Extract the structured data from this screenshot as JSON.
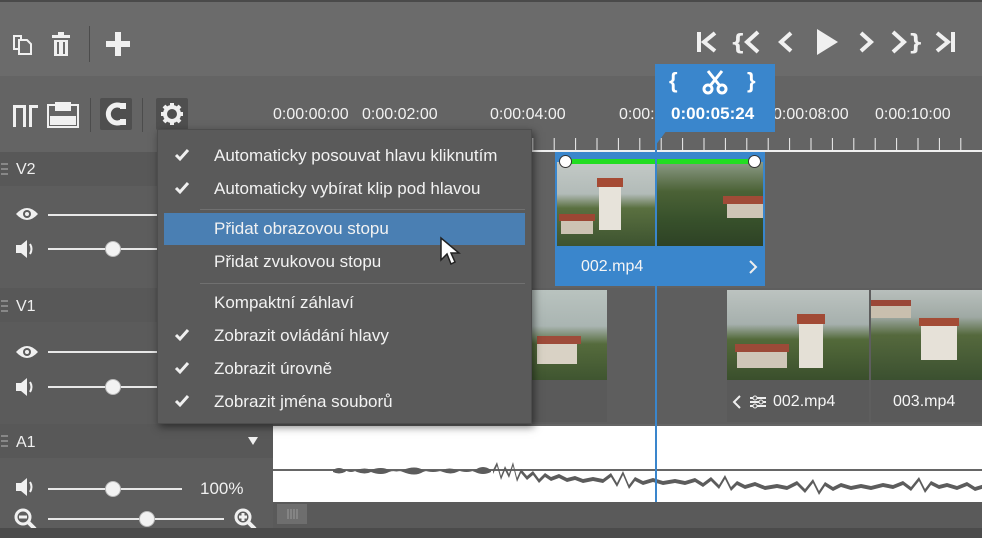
{
  "toolbar": {
    "left_icons": [
      "copy-icon",
      "trash-icon",
      "add-icon"
    ],
    "transport_icons": [
      "skip-to-start-icon",
      "previous-edit-icon",
      "step-back-icon",
      "play-icon",
      "step-forward-icon",
      "next-edit-icon",
      "skip-to-end-icon"
    ],
    "timeline_tools": [
      "ripple-icon",
      "lift-icon",
      "snap-magnet-icon",
      "settings-gear-icon"
    ]
  },
  "playhead": {
    "time": "0:00:05:24",
    "controls": [
      "{",
      "scissors-icon",
      "}"
    ]
  },
  "ruler": {
    "labels": [
      "0:00:00:00",
      "0:00:02:00",
      "0:00:04:00",
      "0:00:0",
      "0:00:08:00",
      "0:00:10:00"
    ]
  },
  "tracks": [
    {
      "name": "V2"
    },
    {
      "name": "V1"
    },
    {
      "name": "A1",
      "level": "100%"
    }
  ],
  "clips": {
    "v2_selected": "002.mp4",
    "v1_a": "002.mp4",
    "v1_b": "003.mp4"
  },
  "menu": {
    "items": [
      {
        "label": "Automaticky posouvat hlavu kliknutím",
        "checked": true
      },
      {
        "label": "Automaticky vybírat klip pod hlavou",
        "checked": true
      },
      {
        "label": "Přidat obrazovou stopu",
        "checked": false,
        "highlighted": true
      },
      {
        "label": "Přidat zvukovou stopu",
        "checked": false
      },
      {
        "label": "Kompaktní záhlaví",
        "checked": false
      },
      {
        "label": "Zobrazit ovládání hlavy",
        "checked": true
      },
      {
        "label": "Zobrazit úrovně",
        "checked": true
      },
      {
        "label": "Zobrazit jména souborů",
        "checked": true
      }
    ]
  },
  "colors": {
    "accent": "#3a86cc",
    "menu_highlight": "#4a7fb3",
    "trim_bar": "#22dd22"
  }
}
